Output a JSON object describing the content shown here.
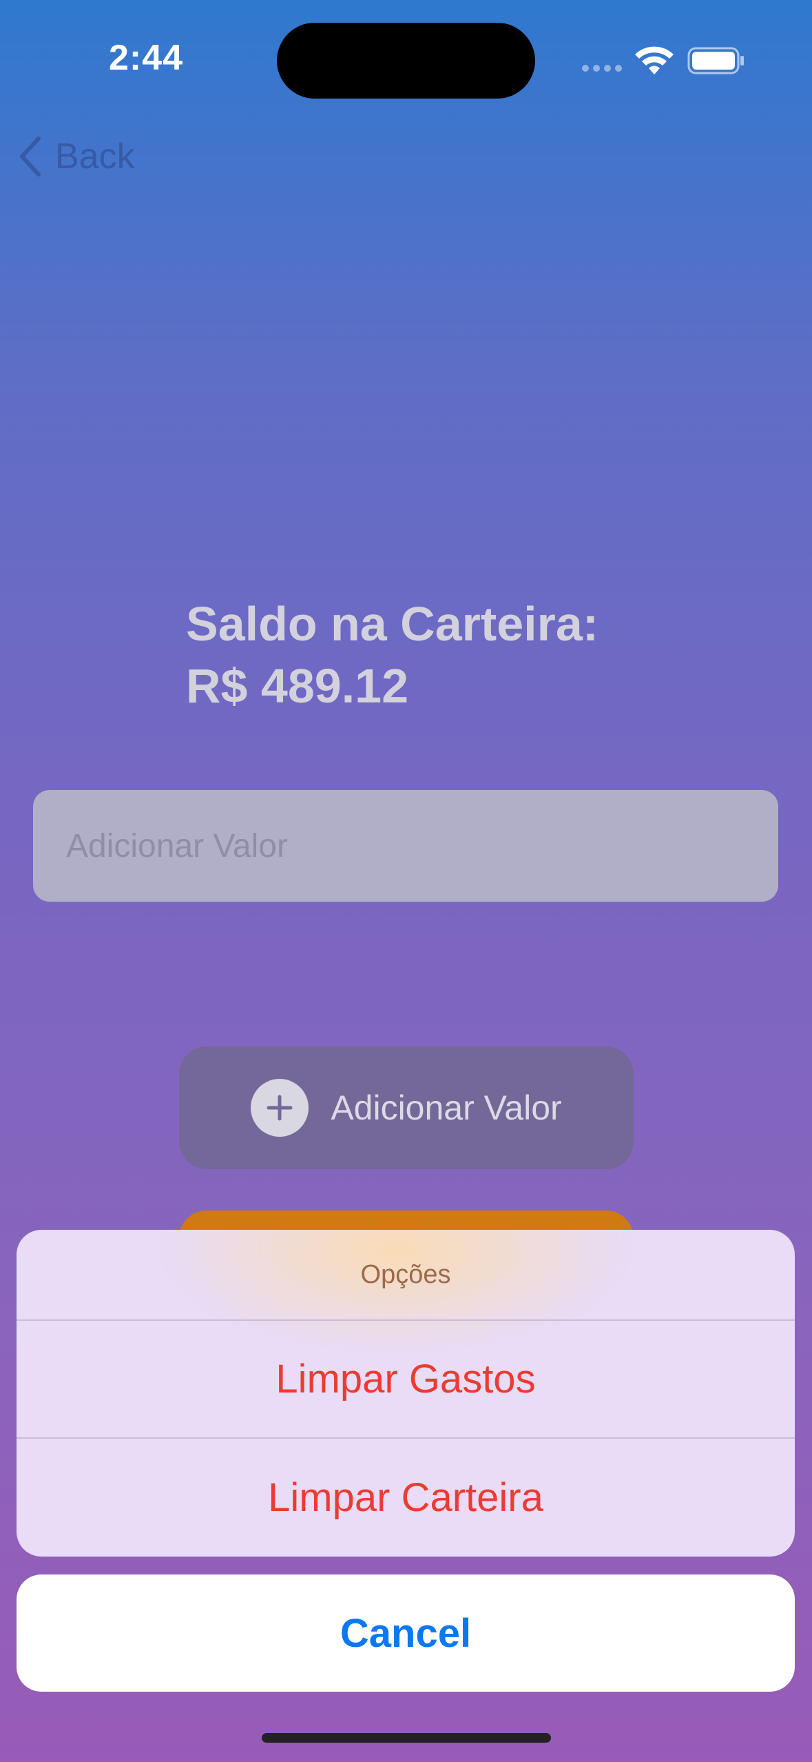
{
  "status_bar": {
    "time": "2:44"
  },
  "nav": {
    "back_label": "Back"
  },
  "wallet": {
    "title": "Saldo na Carteira:",
    "balance": "R$ 489.12"
  },
  "input": {
    "placeholder": "Adicionar Valor"
  },
  "add_button": {
    "label": "Adicionar Valor"
  },
  "action_sheet": {
    "title": "Opções",
    "items": [
      {
        "label": "Limpar Gastos"
      },
      {
        "label": "Limpar Carteira"
      }
    ],
    "cancel_label": "Cancel"
  },
  "colors": {
    "destructive": "#ec3b32",
    "cancel_blue": "#0a78f0",
    "accent_orange": "#d07a10"
  }
}
